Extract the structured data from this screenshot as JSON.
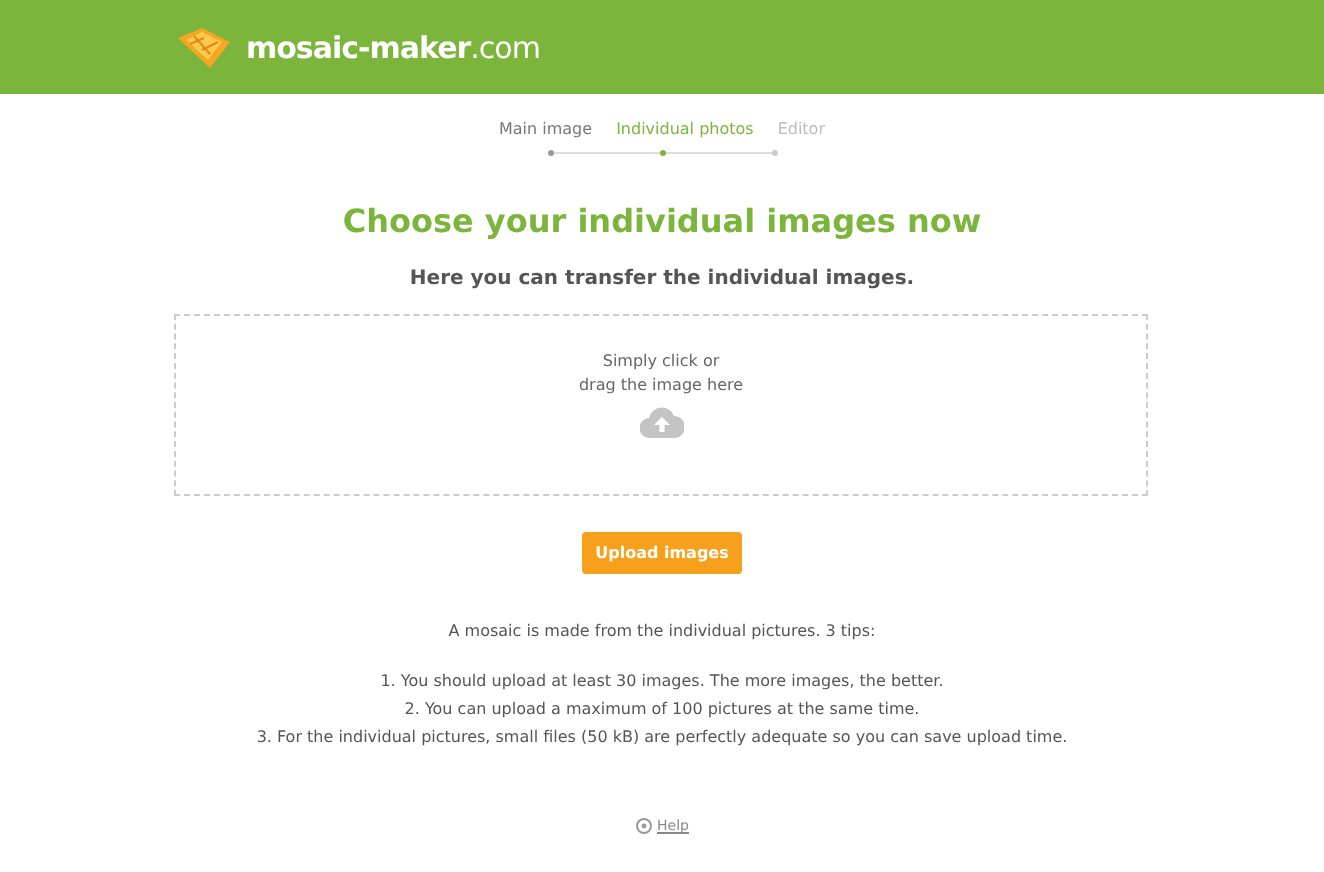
{
  "header": {
    "logo_text": "mosaic-maker",
    "logo_suffix": ".com"
  },
  "steps": [
    {
      "label": "Main image",
      "selected": false,
      "completed": true
    },
    {
      "label": "Individual photos",
      "selected": true,
      "completed": false
    },
    {
      "label": "Editor",
      "selected": false,
      "completed": false
    }
  ],
  "title": "Choose your individual images now",
  "subtitle": "Here you can transfer the individual images.",
  "dropzone": {
    "lines": [
      "Simply click or",
      "drag the image here"
    ]
  },
  "upload_button": "Upload images",
  "intro": "A mosaic is made from the individual pictures. 3 tips:",
  "tips": [
    "1. You should upload at least 30 images. The more images, the better.",
    "2. You can upload a maximum of 100 pictures at the same time.",
    "3. For the individual pictures, small files (50 kB) are perfectly adequate so you can save upload time."
  ],
  "help_link": "Help"
}
